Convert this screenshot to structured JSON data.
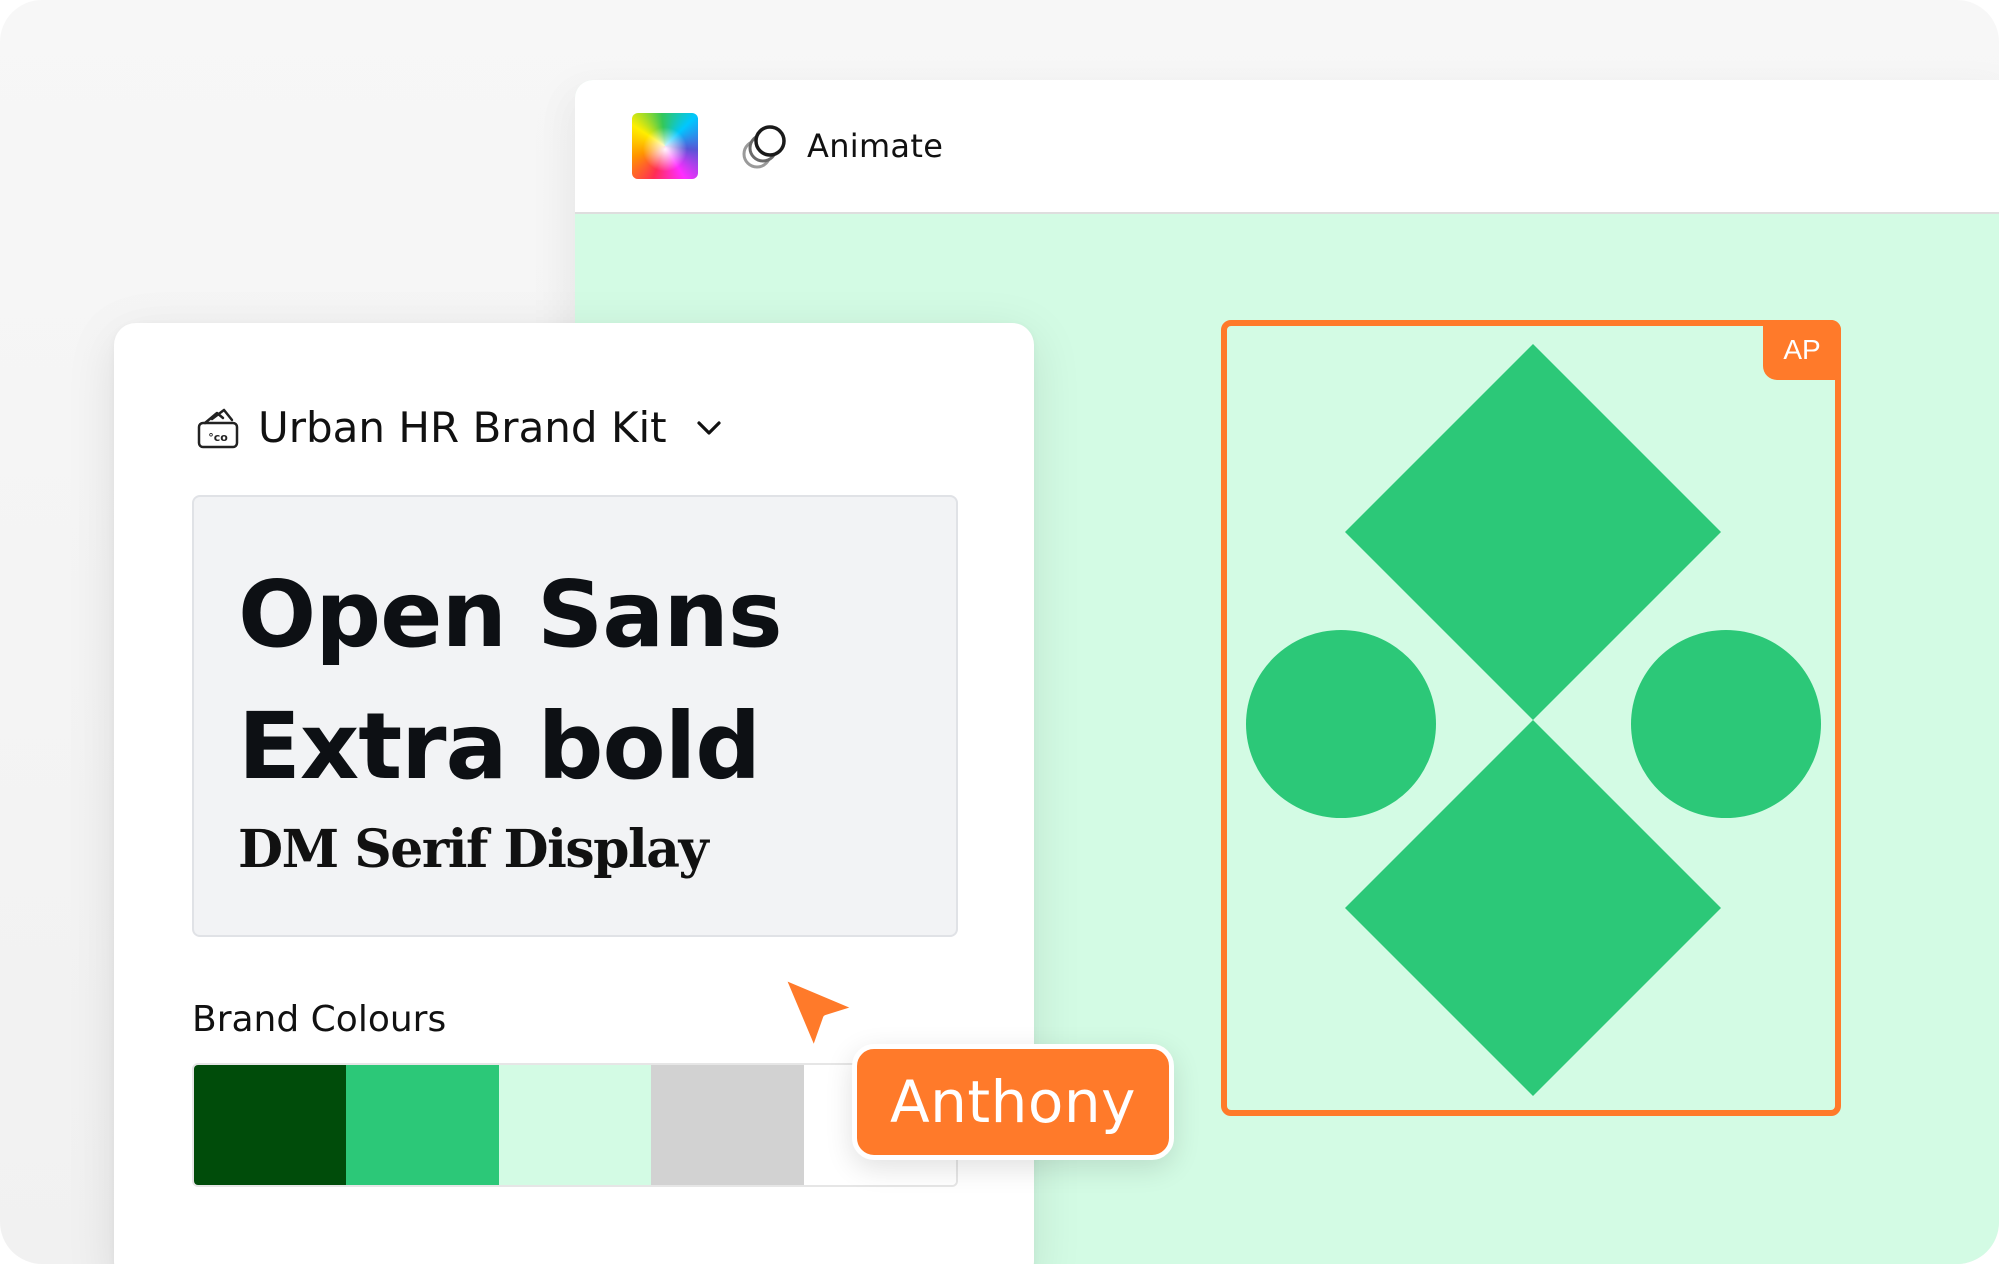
{
  "toolbar": {
    "color_picker_icon": "rainbow-color-picker-icon",
    "animate_icon": "animate-icon",
    "animate_label": "Animate"
  },
  "canvas": {
    "background_color": "#d3fbe4",
    "frame_color": "#ff7a2a",
    "shape_color": "#2cc878",
    "collaborator_badge": "AP"
  },
  "brand_kit": {
    "icon": "brand-kit-icon",
    "title": "Urban HR Brand Kit",
    "dropdown_icon": "chevron-down-icon",
    "fonts": {
      "heading_line1": "Open Sans",
      "heading_line2": "Extra bold",
      "serif": "DM Serif Display"
    },
    "colours_label": "Brand Colours",
    "colours": [
      "#004c0a",
      "#2cc878",
      "#d3fbe4",
      "#d2d2d2",
      "#ffffff"
    ]
  },
  "collaborator": {
    "cursor_icon": "pointer-cursor-icon",
    "name": "Anthony",
    "color": "#ff7a2a"
  }
}
